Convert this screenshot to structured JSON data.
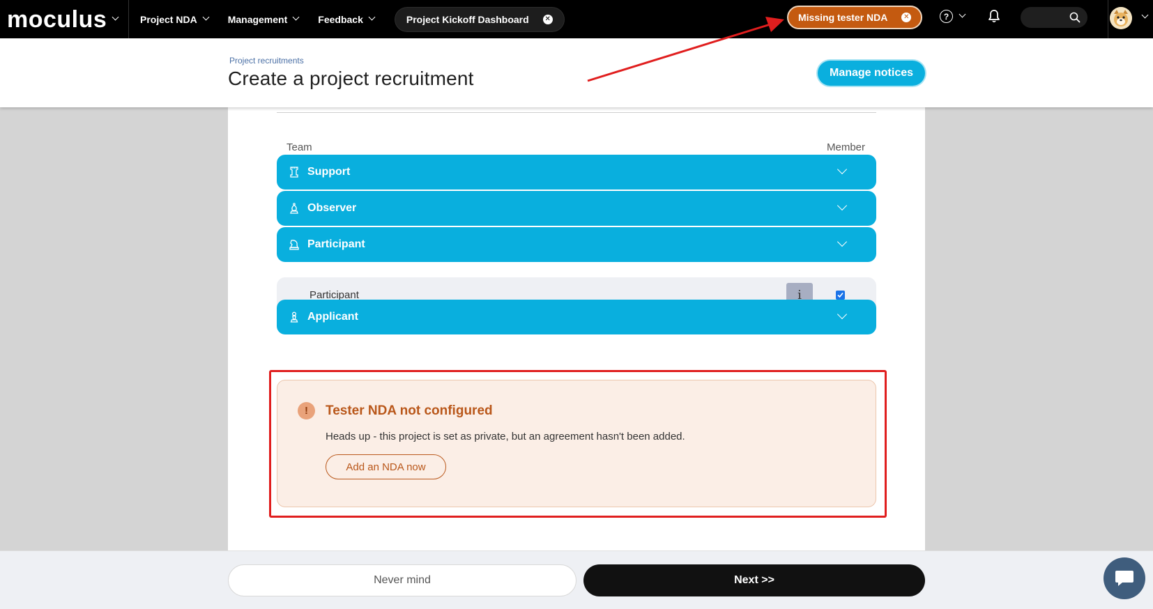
{
  "brand": {
    "logo": "moculus"
  },
  "nav": {
    "items": [
      {
        "label": "Project NDA"
      },
      {
        "label": "Management"
      },
      {
        "label": "Feedback"
      }
    ],
    "open_tab": "Project Kickoff Dashboard",
    "alert_pill": "Missing tester NDA",
    "help_icon": "?"
  },
  "header": {
    "breadcrumb": "Project recruitments",
    "title": "Create a project recruitment",
    "manage_button": "Manage notices"
  },
  "table": {
    "col_team": "Team",
    "col_member": "Member",
    "groups": [
      {
        "label": "Support",
        "icon": "tower-icon"
      },
      {
        "label": "Observer",
        "icon": "bishop-icon"
      },
      {
        "label": "Participant",
        "icon": "queen-icon"
      },
      {
        "label": "Applicant",
        "icon": "pawn-icon"
      }
    ],
    "sub_row": {
      "label": "Participant",
      "info_label": "i",
      "checked": true
    }
  },
  "alert": {
    "icon": "!",
    "title": "Tester NDA not configured",
    "message": "Heads up - this project is set as private, but an agreement hasn't been added.",
    "action": "Add an NDA now"
  },
  "footer": {
    "cancel": "Never mind",
    "next": "Next >>"
  },
  "colors": {
    "accent": "#09afde",
    "warning": "#c45a10",
    "annotation": "#e01e1e"
  }
}
